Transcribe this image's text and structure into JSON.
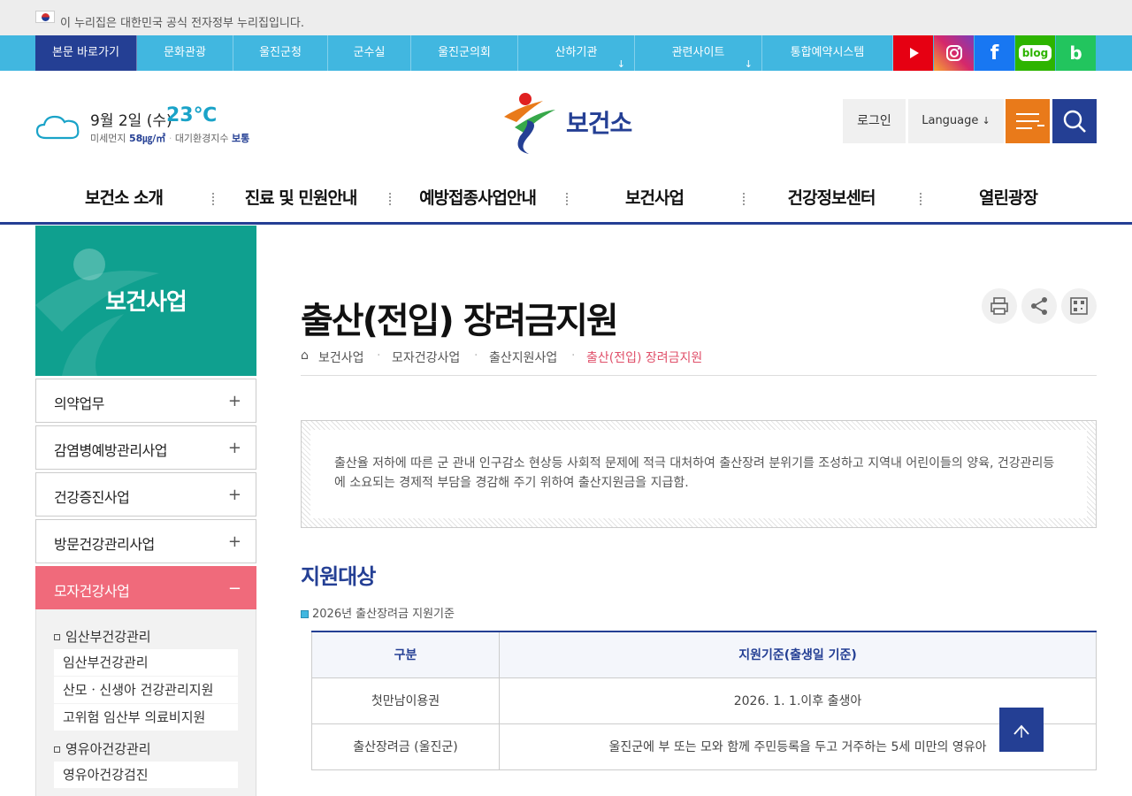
{
  "gov_banner": {
    "text": "이 누리집은 대한민국 공식 전자정부 누리집입니다."
  },
  "util_bar": {
    "skip": "본문 바로가기",
    "links": [
      "문화관광",
      "울진군청",
      "군수실",
      "울진군의회",
      "산하기관",
      "관련사이트",
      "통합예약시스템"
    ],
    "sns": [
      "youtube",
      "instagram",
      "facebook",
      "blog",
      "band"
    ]
  },
  "weather": {
    "date": "9월 2일 (수)",
    "temp": "23℃",
    "dust_label": "미세먼지",
    "dust_value": "58㎍/㎥",
    "air_label": "대기환경지수",
    "air_value": "보통"
  },
  "header": {
    "logo_text": "보건소",
    "login": "로그인",
    "language": "Language"
  },
  "gnb": [
    "보건소 소개",
    "진료 및 민원안내",
    "예방접종사업안내",
    "보건사업",
    "건강정보센터",
    "열린광장"
  ],
  "sidebar": {
    "title": "보건사업",
    "items": [
      {
        "label": "의약업무",
        "toggle": "+"
      },
      {
        "label": "감염병예방관리사업",
        "toggle": "+"
      },
      {
        "label": "건강증진사업",
        "toggle": "+"
      },
      {
        "label": "방문건강관리사업",
        "toggle": "+"
      },
      {
        "label": "모자건강사업",
        "toggle": "−"
      }
    ],
    "sub_head_1": "임산부건강관리",
    "sub_links_1": [
      "임산부건강관리",
      "산모ㆍ신생아 건강관리지원",
      "고위험 임산부 의료비지원"
    ],
    "sub_head_2": "영유아건강관리",
    "sub_links_2": [
      "영유아건강검진"
    ]
  },
  "content": {
    "title": "출산(전입) 장려금지원",
    "breadcrumb": [
      "보건사업",
      "모자건강사업",
      "출산지원사업",
      "출산(전입) 장려금지원"
    ],
    "intro": "출산율 저하에 따른 군 관내 인구감소 현상등 사회적 문제에 적극 대처하여 출산장려 분위기를 조성하고 지역내 어린이들의 양육, 건강관리등에 소요되는 경제적 부담을 경감해 주기 위하여 출산지원금을 지급함.",
    "section_title": "지원대상",
    "bullet": "2026년 출산장려금 지원기준",
    "table": {
      "headers": [
        "구분",
        "지원기준(출생일 기준)"
      ],
      "rows": [
        [
          "첫만남이용권",
          "2026. 1. 1.이후 출생아"
        ],
        [
          "출산장려금 (울진군)",
          "울진군에 부 또는 모와 함께 주민등록을 두고 거주하는 5세 미만의 영유아"
        ]
      ]
    }
  },
  "colors": {
    "navy": "#243f94",
    "sky": "#41b7e0",
    "orange": "#e97a1a",
    "teal": "#0fa08f",
    "pink": "#f06a7b"
  }
}
